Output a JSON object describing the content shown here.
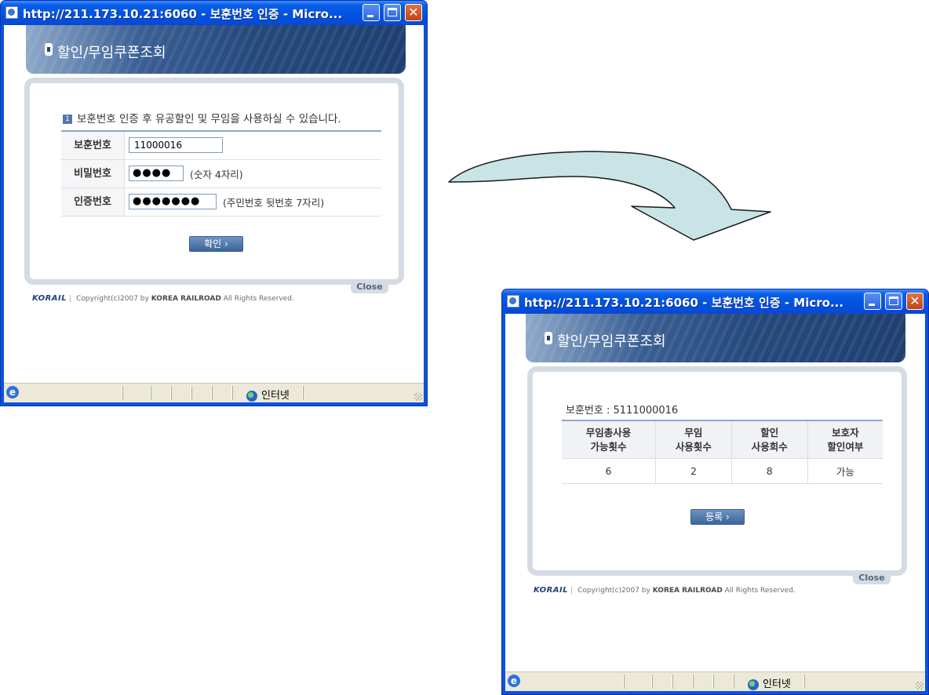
{
  "window1": {
    "title": "http://211.173.10.21:6060 - 보훈번호 인증 - Micro...",
    "page_title": "할인/무임쿠폰조회",
    "notice": "보훈번호 인증 후 유공할인 및 무임을 사용하실 수 있습니다.",
    "form": {
      "fields": [
        {
          "label": "보훈번호",
          "value": "11000016",
          "hint": ""
        },
        {
          "label": "비밀번호",
          "value": "●●●●",
          "hint": "(숫자 4자리)"
        },
        {
          "label": "인증번호",
          "value": "●●●●●●●",
          "hint": "(주민번호 뒷번호 7자리)"
        }
      ]
    },
    "confirm_button": "확인 ›",
    "close_label": "Close",
    "footer": {
      "logo": "KORAIL",
      "copyright": "Copyright(c)2007 by",
      "company": "KOREA RAILROAD",
      "rights": "All Rights Reserved."
    },
    "status": {
      "zone": "인터넷"
    }
  },
  "window2": {
    "title": "http://211.173.10.21:6060 - 보훈번호 인증 - Micro...",
    "page_title": "할인/무임쿠폰조회",
    "info": "보훈번호 : 5111000016",
    "table": {
      "headers": [
        [
          "무임총사용",
          "가능횟수"
        ],
        [
          "무임",
          "사용횟수"
        ],
        [
          "할인",
          "사용회수"
        ],
        [
          "보호자",
          "할인여부"
        ]
      ],
      "rows": [
        [
          "6",
          "2",
          "8",
          "가능"
        ]
      ]
    },
    "register_button": "등록 ›",
    "close_label": "Close",
    "footer": {
      "logo": "KORAIL",
      "copyright": "Copyright(c)2007 by",
      "company": "KOREA RAILROAD",
      "rights": "All Rights Reserved."
    },
    "status": {
      "zone": "인터넷"
    }
  },
  "colors": {
    "xp_title": "#0054e3",
    "header": "#25497c",
    "frame": "#d4dbe4",
    "arrow_fill": "#c8e4e6"
  }
}
